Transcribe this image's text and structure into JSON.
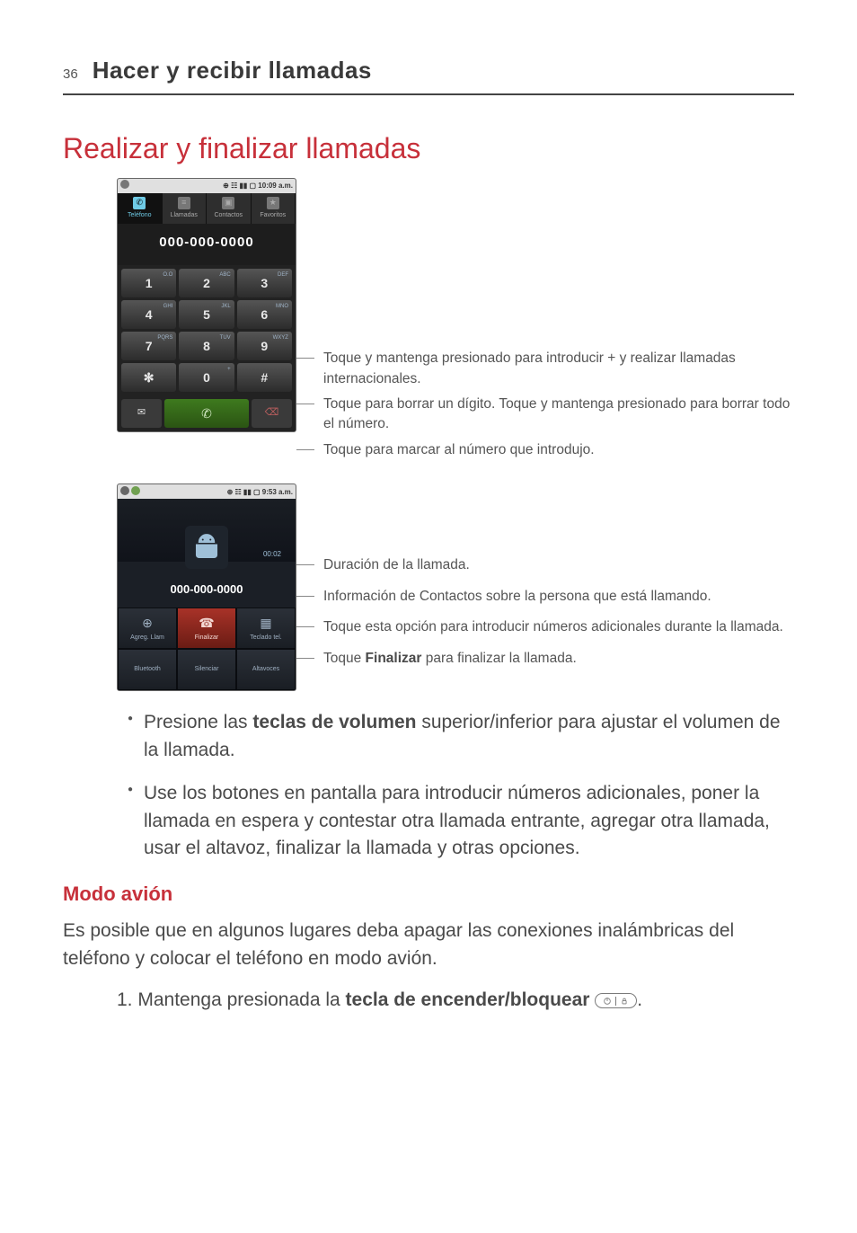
{
  "page": {
    "number": "36",
    "header": "Hacer y recibir llamadas"
  },
  "heading": "Realizar y finalizar llamadas",
  "phone1": {
    "status_time": "10:09 a.m.",
    "tabs": {
      "telefono": "Teléfono",
      "llamadas": "Llamadas",
      "contactos": "Contactos",
      "favoritos": "Favoritos"
    },
    "number": "000-000-0000",
    "keys": {
      "k1": "1",
      "k1s": "O.O",
      "k2": "2",
      "k2s": "ABC",
      "k3": "3",
      "k3s": "DEF",
      "k4": "4",
      "k4s": "GHI",
      "k5": "5",
      "k5s": "JKL",
      "k6": "6",
      "k6s": "MNO",
      "k7": "7",
      "k7s": "PQRS",
      "k8": "8",
      "k8s": "TUV",
      "k9": "9",
      "k9s": "WXYZ",
      "ks": "✻",
      "k0": "0",
      "k0s": "+",
      "kh": "#"
    },
    "del_icon": "⌫"
  },
  "callouts1": {
    "a": "Toque y mantenga presionado para introducir + y realizar llamadas internacionales.",
    "b": "Toque para borrar un dígito. Toque y mantenga presionado para borrar todo el número.",
    "c": "Toque para marcar al número que introdujo."
  },
  "phone2": {
    "status_time": "9:53 a.m.",
    "duration": "00:02",
    "contact": "000-000-0000",
    "buttons": {
      "agreg": "Agreg. Llam",
      "finalizar": "Finalizar",
      "teclado": "Teclado tel.",
      "bluetooth": "Bluetooth",
      "silenciar": "Silenciar",
      "altavoces": "Altavoces"
    }
  },
  "callouts2": {
    "a": "Duración de la llamada.",
    "b": "Información de Contactos sobre la persona que está llamando.",
    "c": "Toque esta opción para introducir números adicionales durante la llamada.",
    "d_pre": "Toque ",
    "d_b": "Finalizar",
    "d_post": " para finalizar la llamada."
  },
  "bullets": {
    "b1_pre": "Presione las ",
    "b1_b": "teclas de volumen",
    "b1_post": " superior/inferior para ajustar el volumen de la llamada.",
    "b2": "Use los botones en pantalla para introducir números adicionales, poner la llamada en espera y contestar otra llamada entrante, agregar otra llamada, usar el altavoz, finalizar la llamada y otras opciones."
  },
  "subheading": "Modo avión",
  "para": "Es posible que en algunos lugares deba apagar las conexiones inalámbricas del teléfono y colocar el teléfono en modo avión.",
  "numlist": {
    "n1_pre": "1. Mantenga presionada la ",
    "n1_b": "tecla de encender/bloquear",
    "n1_post": " "
  },
  "period": "."
}
